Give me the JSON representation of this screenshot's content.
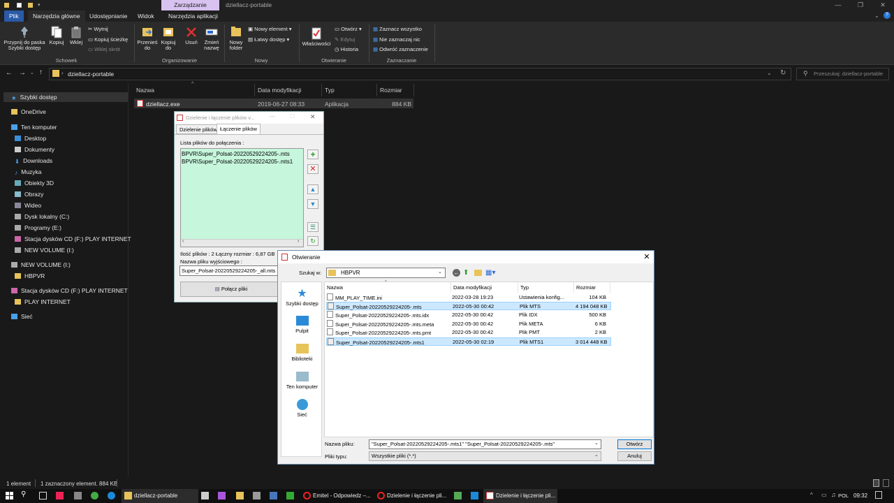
{
  "titlebar": {
    "context_tab": "Zarządzanie",
    "title": "dziellacz-portable",
    "min": "—",
    "max": "❐",
    "close": "✕"
  },
  "ribbon_tabs": [
    "Plik",
    "Narzędzia główne",
    "Udostępnianie",
    "Widok",
    "Narzędzia aplikacji"
  ],
  "ribbon": {
    "pin": "Przypnij do paska Szybki dostęp",
    "copy": "Kopiuj",
    "paste": "Wklej",
    "cut": "Wytnij",
    "copy_path": "Kopiuj ścieżkę",
    "paste_shortcut": "Wklej skrót",
    "move_to": "Przenieś do",
    "copy_to": "Kopiuj do",
    "delete": "Usuń",
    "rename": "Zmień nazwę",
    "new_folder": "Nowy folder",
    "new_item": "Nowy element ▾",
    "easy_access": "Łatwy dostęp ▾",
    "properties": "Właściwości",
    "open": "Otwórz ▾",
    "edit": "Edytuj",
    "history": "Historia",
    "select_all": "Zaznacz wszystko",
    "select_none": "Nie zaznaczaj nic",
    "invert": "Odwróć zaznaczenie",
    "groups": [
      "Schowek",
      "Organizowanie",
      "Nowy",
      "Otwieranie",
      "Zaznaczanie"
    ]
  },
  "address": {
    "path": "dziellacz-portable",
    "search_placeholder": "Przeszukaj: dziellacz-portable"
  },
  "nav": {
    "quick": "Szybki dostęp",
    "onedrive": "OneDrive",
    "pc": "Ten komputer",
    "items": [
      "Desktop",
      "Dokumenty",
      "Downloads",
      "Muzyka",
      "Obiekty 3D",
      "Obrazy",
      "Wideo",
      "Dysk lokalny (C:)",
      "Programy (E:)",
      "Stacja dysków CD (F:) PLAY INTERNET",
      "NEW VOLUME (I:)"
    ],
    "newvol": "NEW VOLUME (I:)",
    "hbpvr": "HBPVR",
    "cdrive": "Stacja dysków CD (F:) PLAY INTERNET",
    "playinternet": "PLAY INTERNET",
    "network": "Sieć"
  },
  "columns": {
    "name": "Nazwa",
    "date": "Data modyfikacji",
    "type": "Typ",
    "size": "Rozmiar"
  },
  "file": {
    "name": "dziellacz.exe",
    "date": "2019-06-27 08:33",
    "type": "Aplikacja",
    "size": "884 KB"
  },
  "status": {
    "count": "1 element",
    "selected": "1 zaznaczony element. 884 KB"
  },
  "splitter": {
    "title": "Dzielenie i łączenie plików v...",
    "tab_split": "Dzielenie plików",
    "tab_join": "Łączenie plików",
    "list_label": "Lista plików do połączenia :",
    "files": [
      "BPVR\\Super_Polsat-20220529224205-.mts",
      "BPVR\\Super_Polsat-20220529224205-.mts1"
    ],
    "info": "Ilość plików : 2  Łączny rozmiar : 6,87 GB",
    "out_label": "Nazwa pliku wyjściowego :",
    "out_value": "Super_Polsat-20220529224205-_all.mts",
    "join_button": "Połącz pliki"
  },
  "open_dialog": {
    "title": "Otwieranie",
    "look_in_label": "Szukaj w:",
    "look_in_value": "HBPVR",
    "places": [
      "Szybki dostęp",
      "Pulpit",
      "Biblioteki",
      "Ten komputer",
      "Sieć"
    ],
    "columns": {
      "name": "Nazwa",
      "date": "Data modyfikacji",
      "type": "Typ",
      "size": "Rozmiar"
    },
    "rows": [
      {
        "name": "MM_PLAY_TIME.ini",
        "date": "2022-03-28 19:23",
        "type": "Ustawienia konfig...",
        "size": "104 KB"
      },
      {
        "name": "Super_Polsat-20220529224205-.mts",
        "date": "2022-05-30 00:42",
        "type": "Plik MTS",
        "size": "4 194 048 KB"
      },
      {
        "name": "Super_Polsat-20220529224205-.mts.idx",
        "date": "2022-05-30 00:42",
        "type": "Plik IDX",
        "size": "500 KB"
      },
      {
        "name": "Super_Polsat-20220529224205-.mts.meta",
        "date": "2022-05-30 00:42",
        "type": "Plik META",
        "size": "6 KB"
      },
      {
        "name": "Super_Polsat-20220529224205-.mts.pmt",
        "date": "2022-05-30 00:42",
        "type": "Plik PMT",
        "size": "2 KB"
      },
      {
        "name": "Super_Polsat-20220529224205-.mts1",
        "date": "2022-05-30 02:19",
        "type": "Plik MTS1",
        "size": "3 014 448 KB"
      }
    ],
    "filename_label": "Nazwa pliku:",
    "filename_value": "\"Super_Polsat-20220529224205-.mts1\" \"Super_Polsat-20220529224205-.mts\"",
    "filetype_label": "Pliki typu:",
    "filetype_value": "Wszystkie pliki (*.*)",
    "open_button": "Otwórz",
    "cancel_button": "Anuluj"
  },
  "taskbar": {
    "apps": [
      "dziellacz-portable",
      "Emitel - Odpowiedz –...",
      "Dzielenie i łączenie pli...",
      "Dzielenie i łączenie pli..."
    ],
    "lang": "POL",
    "time": "09:32"
  }
}
